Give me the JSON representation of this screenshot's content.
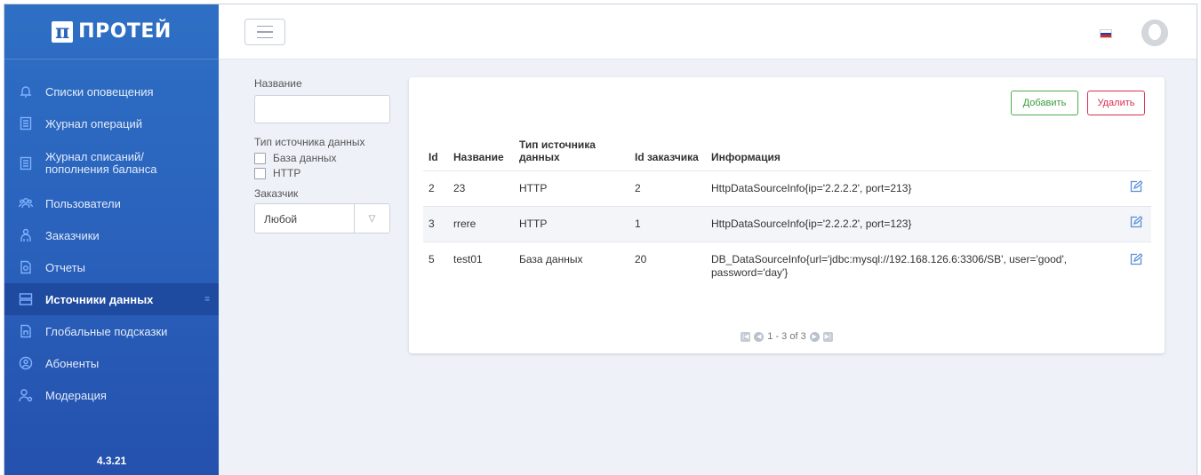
{
  "brand": {
    "mark": "π",
    "name": "ПРОТЕЙ"
  },
  "sidebar": {
    "items": [
      {
        "label": "Списки оповещения",
        "icon": "bell-icon"
      },
      {
        "label": "Журнал операций",
        "icon": "journal-icon"
      },
      {
        "label": "Журнал списаний/ пополнения баланса",
        "icon": "balance-journal-icon"
      },
      {
        "label": "Пользователи",
        "icon": "users-icon"
      },
      {
        "label": "Заказчики",
        "icon": "customers-icon"
      },
      {
        "label": "Отчеты",
        "icon": "report-icon"
      },
      {
        "label": "Источники данных",
        "icon": "data-sources-icon",
        "active": true
      },
      {
        "label": "Глобальные подсказки",
        "icon": "hints-icon"
      },
      {
        "label": "Абоненты",
        "icon": "subscribers-icon"
      },
      {
        "label": "Модерация",
        "icon": "moderation-icon"
      }
    ],
    "version": "4.3.21"
  },
  "filters": {
    "name_label": "Название",
    "name_value": "",
    "type_label": "Тип источника данных",
    "type_options": [
      "База данных",
      "HTTP"
    ],
    "customer_label": "Заказчик",
    "customer_value": "Любой"
  },
  "toolbar": {
    "add_label": "Добавить",
    "delete_label": "Удалить"
  },
  "table": {
    "headers": [
      "Id",
      "Название",
      "Тип источника данных",
      "Id заказчика",
      "Информация"
    ],
    "rows": [
      {
        "id": "2",
        "name": "23",
        "type": "HTTP",
        "customer_id": "2",
        "info": "HttpDataSourceInfo{ip='2.2.2.2', port=213}"
      },
      {
        "id": "3",
        "name": "rrere",
        "type": "HTTP",
        "customer_id": "1",
        "info": "HttpDataSourceInfo{ip='2.2.2.2', port=123}"
      },
      {
        "id": "5",
        "name": "test01",
        "type": "База данных",
        "customer_id": "20",
        "info": "DB_DataSourceInfo{url='jdbc:mysql://192.168.126.6:3306/SB', user='good', password='day'}"
      }
    ]
  },
  "pager": {
    "text": "1 - 3 of 3"
  },
  "colors": {
    "sidebar": "#2a63bd",
    "add": "#4cae4c",
    "delete": "#d9304f"
  }
}
